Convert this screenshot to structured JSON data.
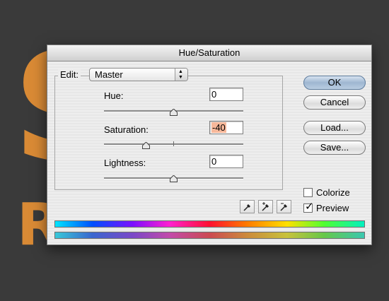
{
  "dialog": {
    "title": "Hue/Saturation"
  },
  "edit": {
    "label": "Edit:",
    "selected": "Master"
  },
  "hue": {
    "label": "Hue:",
    "value": "0",
    "slider_fraction": 0.5
  },
  "saturation": {
    "label": "Saturation:",
    "value": "-40",
    "slider_fraction": 0.3
  },
  "lightness": {
    "label": "Lightness:",
    "value": "0",
    "slider_fraction": 0.5
  },
  "buttons": {
    "ok": "OK",
    "cancel": "Cancel",
    "load": "Load...",
    "save": "Save..."
  },
  "options": {
    "colorize_label": "Colorize",
    "colorize_checked": false,
    "preview_label": "Preview",
    "preview_checked": true
  },
  "eyedroppers": [
    {
      "name": "eyedropper-icon"
    },
    {
      "name": "eyedropper-plus-icon"
    },
    {
      "name": "eyedropper-minus-icon"
    }
  ],
  "colors": {
    "accent_highlight": "#f7b89a",
    "background_artwork": "#d98a35"
  }
}
